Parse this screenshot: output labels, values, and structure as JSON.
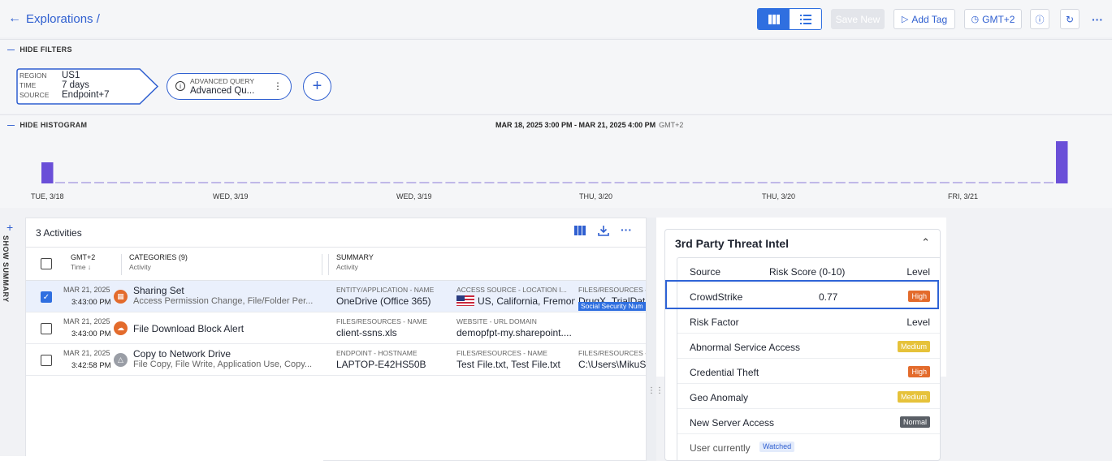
{
  "topbar": {
    "breadcrumb": "Explorations /",
    "save_label": "Save New",
    "add_tag_label": "Add Tag",
    "tz_label": "GMT+2"
  },
  "filters": {
    "toggle_label": "HIDE FILTERS",
    "pill1": {
      "rows": [
        {
          "key": "REGION",
          "value": "US1"
        },
        {
          "key": "TIME",
          "value": "7 days"
        },
        {
          "key": "SOURCE",
          "value": "Endpoint+7"
        }
      ]
    },
    "pill2": {
      "label": "ADVANCED QUERY",
      "value": "Advanced Qu..."
    }
  },
  "histogram": {
    "toggle_label": "HIDE HISTOGRAM",
    "range": "MAR 18, 2025 3:00 PM - MAR 21, 2025 4:00 PM",
    "tz": "GMT+2",
    "ticks": [
      "TUE, 3/18",
      "WED, 3/19",
      "WED, 3/19",
      "THU, 3/20",
      "THU, 3/20",
      "FRI, 3/21"
    ],
    "bar_color": "#6a4fd8",
    "levels": [
      1,
      0,
      0,
      0,
      0,
      0,
      0,
      0,
      0,
      0,
      0,
      0,
      0,
      0,
      0,
      0,
      0,
      0,
      0,
      0,
      0,
      0,
      0,
      0,
      0,
      0,
      0,
      0,
      0,
      0,
      0,
      0,
      0,
      0,
      0,
      0,
      0,
      0,
      0,
      0,
      0,
      0,
      0,
      0,
      0,
      0,
      0,
      0,
      0,
      0,
      0,
      0,
      0,
      0,
      0,
      0,
      0,
      0,
      0,
      0,
      0,
      0,
      0,
      0,
      0,
      0,
      0,
      0,
      0,
      0,
      0,
      0,
      0,
      0,
      0,
      0,
      0,
      0,
      2
    ]
  },
  "summary_tab": "SHOW SUMMARY",
  "activities": {
    "title": "3 Activities",
    "columns": {
      "time_top": "GMT+2",
      "time_sub": "Time ↓",
      "cat_top": "CATEGORIES (9)",
      "cat_sub": "Activity",
      "sum_top": "SUMMARY",
      "sum_sub": "Activity"
    },
    "rows": [
      {
        "date": "MAR 21, 2025",
        "time": "3:43:00 PM",
        "title": "Sharing Set",
        "subtitle": "Access Permission Change, File/Folder Per...",
        "s1_label": "ENTITY/APPLICATION - NAME",
        "s1_value": "OneDrive (Office 365)",
        "s2_label": "ACCESS SOURCE - LOCATION I...",
        "s2_value": "US, California, Fremon",
        "s3_label": "FILES/RESOURCES -",
        "s3_value": "DrugX_TrialData",
        "s3_tag": "Social Security Num",
        "icon_color": "#e36b2c"
      },
      {
        "date": "MAR 21, 2025",
        "time": "3:43:00 PM",
        "title": "File Download Block Alert",
        "s1_label": "FILES/RESOURCES - NAME",
        "s1_value": "client-ssns.xls",
        "s2_label": "WEBSITE - URL DOMAIN",
        "s2_value": "demopfpt-my.sharepoint....",
        "icon_color": "#e36b2c"
      },
      {
        "date": "MAR 21, 2025",
        "time": "3:42:58 PM",
        "title": "Copy to Network Drive",
        "subtitle": "File Copy, File Write, Application Use, Copy...",
        "s1_label": "ENDPOINT - HOSTNAME",
        "s1_value": "LAPTOP-E42HS50B",
        "s2_label": "FILES/RESOURCES - NAME",
        "s2_value": "Test File.txt, Test File.txt",
        "s3_label": "FILES/RESOURCES -",
        "s3_value": "C:\\Users\\MikuSu",
        "icon_color": "#9a9ea6"
      }
    ]
  },
  "threat": {
    "title": "3rd Party Threat Intel",
    "head": {
      "source": "Source",
      "score": "Risk Score (0-10)",
      "level": "Level"
    },
    "crowdstrike": {
      "source": "CrowdStrike",
      "score": "0.77",
      "level": "High"
    },
    "factor_head": {
      "factor": "Risk Factor",
      "level": "Level"
    },
    "factors": [
      {
        "name": "Abnormal Service Access",
        "level": "Medium"
      },
      {
        "name": "Credential Theft",
        "level": "High"
      },
      {
        "name": "Geo Anomaly",
        "level": "Medium"
      },
      {
        "name": "New Server Access",
        "level": "Normal"
      }
    ],
    "last": {
      "text": "User currently",
      "badge": "Watched"
    }
  }
}
